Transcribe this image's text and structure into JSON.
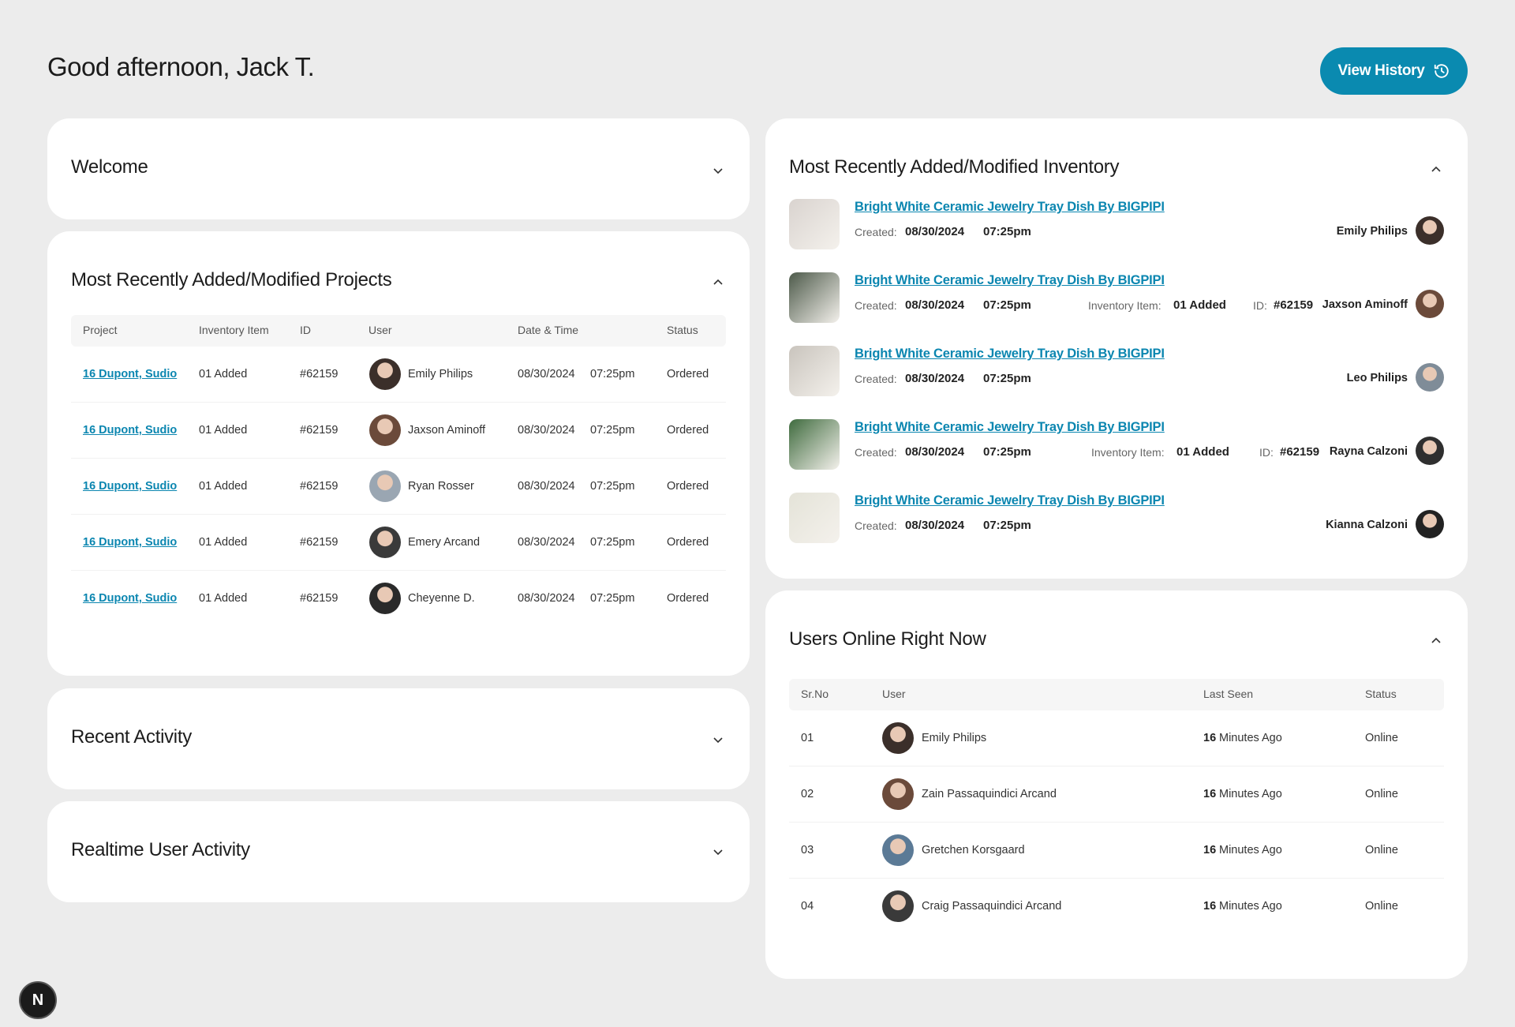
{
  "header": {
    "greeting": "Good afternoon, Jack T.",
    "view_history_label": "View History",
    "history_icon": "history-clock-icon"
  },
  "welcome": {
    "title": "Welcome"
  },
  "projects": {
    "title": "Most Recently Added/Modified Projects",
    "columns": [
      "Project",
      "Inventory Item",
      "ID",
      "User",
      "Date & Time",
      "Status"
    ],
    "rows": [
      {
        "project": "16 Dupont, Sudio",
        "inventory": "01 Added",
        "id": "#62159",
        "user": "Emily Philips",
        "date": "08/30/2024",
        "time": "07:25pm",
        "status": "Ordered",
        "avatar_color": "#3b2f2a"
      },
      {
        "project": "16 Dupont, Sudio",
        "inventory": "01 Added",
        "id": "#62159",
        "user": "Jaxson Aminoff",
        "date": "08/30/2024",
        "time": "07:25pm",
        "status": "Ordered",
        "avatar_color": "#6b4a3a"
      },
      {
        "project": "16 Dupont, Sudio",
        "inventory": "01 Added",
        "id": "#62159",
        "user": "Ryan Rosser",
        "date": "08/30/2024",
        "time": "07:25pm",
        "status": "Ordered",
        "avatar_color": "#9aa6b2"
      },
      {
        "project": "16 Dupont, Sudio",
        "inventory": "01 Added",
        "id": "#62159",
        "user": "Emery Arcand",
        "date": "08/30/2024",
        "time": "07:25pm",
        "status": "Ordered",
        "avatar_color": "#3a3a3a"
      },
      {
        "project": "16 Dupont, Sudio",
        "inventory": "01 Added",
        "id": "#62159",
        "user": "Cheyenne D.",
        "date": "08/30/2024",
        "time": "07:25pm",
        "status": "Ordered",
        "avatar_color": "#2a2a2a"
      }
    ]
  },
  "recent_activity": {
    "title": "Recent Activity"
  },
  "realtime": {
    "title": "Realtime User Activity"
  },
  "inventory": {
    "title": "Most Recently Added/Modified Inventory",
    "created_label": "Created:",
    "inventory_item_label": "Inventory Item:",
    "id_label": "ID:",
    "items": [
      {
        "title": "Bright White Ceramic Jewelry Tray Dish By BIGPIPI",
        "date": "08/30/2024",
        "time": "07:25pm",
        "inventory": "",
        "id": "",
        "user": "Emily Philips",
        "thumb_color": "#d9d3cf",
        "avatar_color": "#3b2f2a"
      },
      {
        "title": "Bright White Ceramic Jewelry Tray Dish By BIGPIPI",
        "date": "08/30/2024",
        "time": "07:25pm",
        "inventory": "01 Added",
        "id": "#62159",
        "user": "Jaxson Aminoff",
        "thumb_color": "#4d5a4a",
        "avatar_color": "#6b4a3a"
      },
      {
        "title": "Bright White Ceramic Jewelry Tray Dish By BIGPIPI",
        "date": "08/30/2024",
        "time": "07:25pm",
        "inventory": "",
        "id": "",
        "user": "Leo Philips",
        "thumb_color": "#c9c4bd",
        "avatar_color": "#7f8c98"
      },
      {
        "title": "Bright White Ceramic Jewelry Tray Dish By BIGPIPI",
        "date": "08/30/2024",
        "time": "07:25pm",
        "inventory": "01 Added",
        "id": "#62159",
        "user": "Rayna Calzoni",
        "thumb_color": "#3f6b3e",
        "avatar_color": "#2f2f2f"
      },
      {
        "title": "Bright White Ceramic Jewelry Tray Dish By BIGPIPI",
        "date": "08/30/2024",
        "time": "07:25pm",
        "inventory": "",
        "id": "",
        "user": "Kianna Calzoni",
        "thumb_color": "#e4e3d8",
        "avatar_color": "#222222"
      }
    ]
  },
  "users_online": {
    "title": "Users Online Right Now",
    "columns": [
      "Sr.No",
      "User",
      "Last Seen",
      "Status"
    ],
    "rows": [
      {
        "no": "01",
        "user": "Emily Philips",
        "last_seen_num": "16",
        "last_seen_text": "Minutes Ago",
        "status": "Online",
        "avatar_color": "#3b2f2a"
      },
      {
        "no": "02",
        "user": "Zain Passaquindici Arcand",
        "last_seen_num": "16",
        "last_seen_text": "Minutes Ago",
        "status": "Online",
        "avatar_color": "#6b4a3a"
      },
      {
        "no": "03",
        "user": "Gretchen Korsgaard",
        "last_seen_num": "16",
        "last_seen_text": "Minutes Ago",
        "status": "Online",
        "avatar_color": "#5b7a96"
      },
      {
        "no": "04",
        "user": "Craig Passaquindici Arcand",
        "last_seen_num": "16",
        "last_seen_text": "Minutes Ago",
        "status": "Online",
        "avatar_color": "#3a3a3a"
      }
    ]
  },
  "badge": {
    "letter": "N"
  },
  "colors": {
    "accent": "#0a8ab0",
    "background": "#ececec",
    "card": "#ffffff"
  }
}
